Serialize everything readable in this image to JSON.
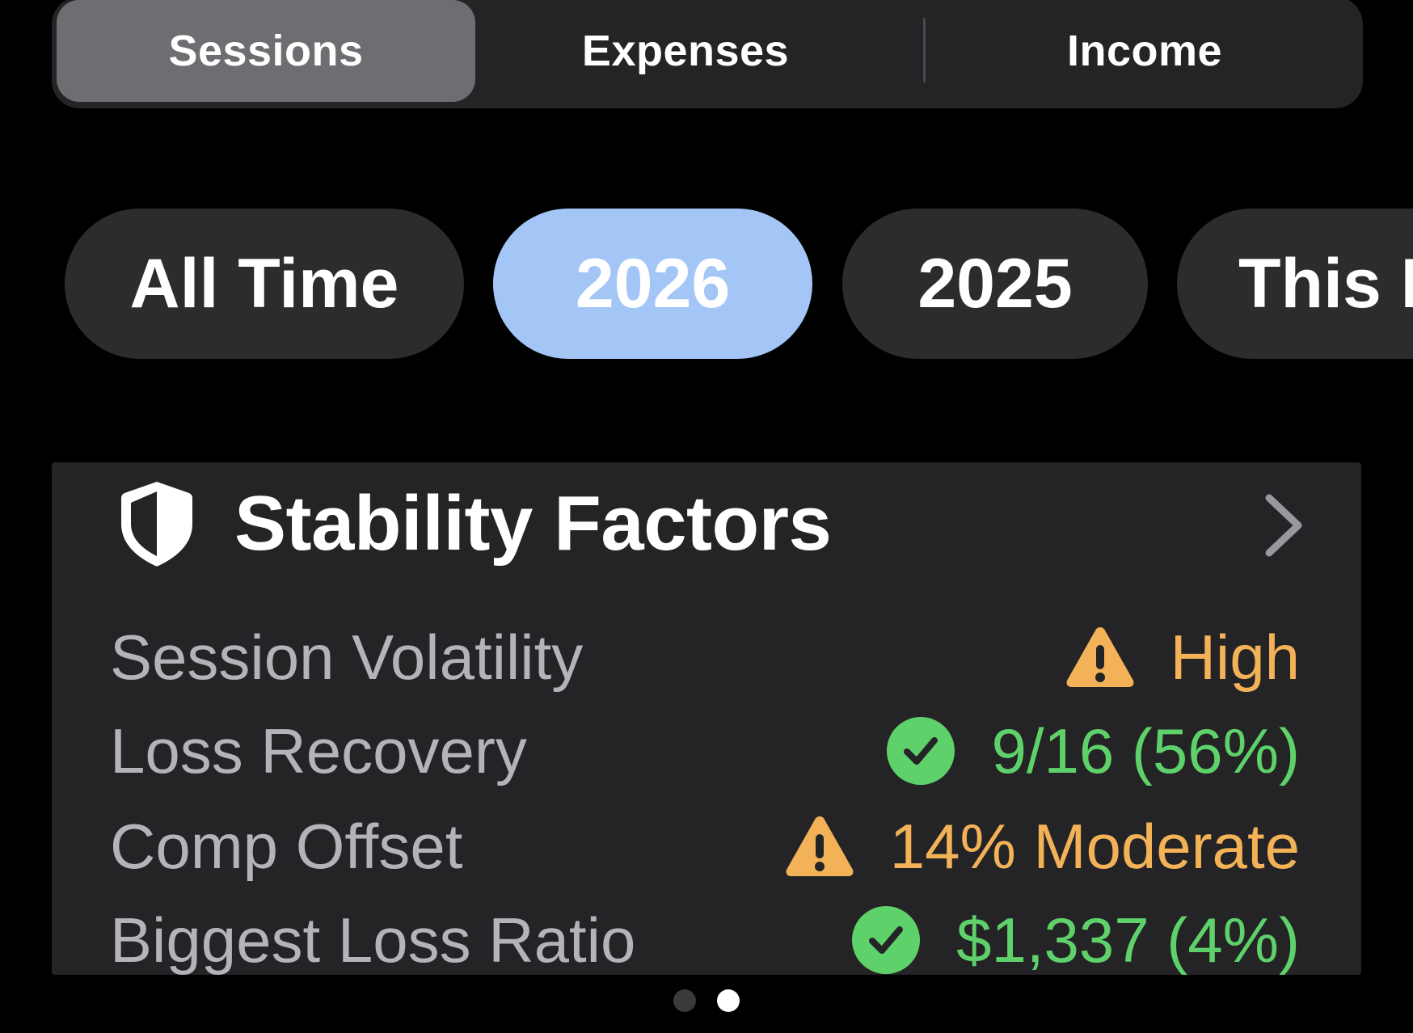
{
  "segmented": {
    "items": [
      "Sessions",
      "Expenses",
      "Income"
    ],
    "selected": "Sessions"
  },
  "filters": {
    "chips": [
      "All Time",
      "2026",
      "2025",
      "This Month"
    ],
    "visible_chip_4": "This I",
    "selected": "2026"
  },
  "card": {
    "title": "Stability Factors",
    "icon": "shield-icon",
    "rows": [
      {
        "label": "Session Volatility",
        "value": "High",
        "status": "warning"
      },
      {
        "label": "Loss Recovery",
        "value": "9/16 (56%)",
        "status": "ok"
      },
      {
        "label": "Comp Offset",
        "value": "14% Moderate",
        "status": "warning"
      },
      {
        "label": "Biggest Loss Ratio",
        "value": "$1,337 (4%)",
        "status": "ok"
      }
    ]
  },
  "pagination": {
    "pages": 2,
    "current": 2
  },
  "colors": {
    "warning": "#f3b257",
    "ok": "#5fd16b",
    "selected_chip": "#a3c6f7",
    "card_bg": "#242426"
  }
}
